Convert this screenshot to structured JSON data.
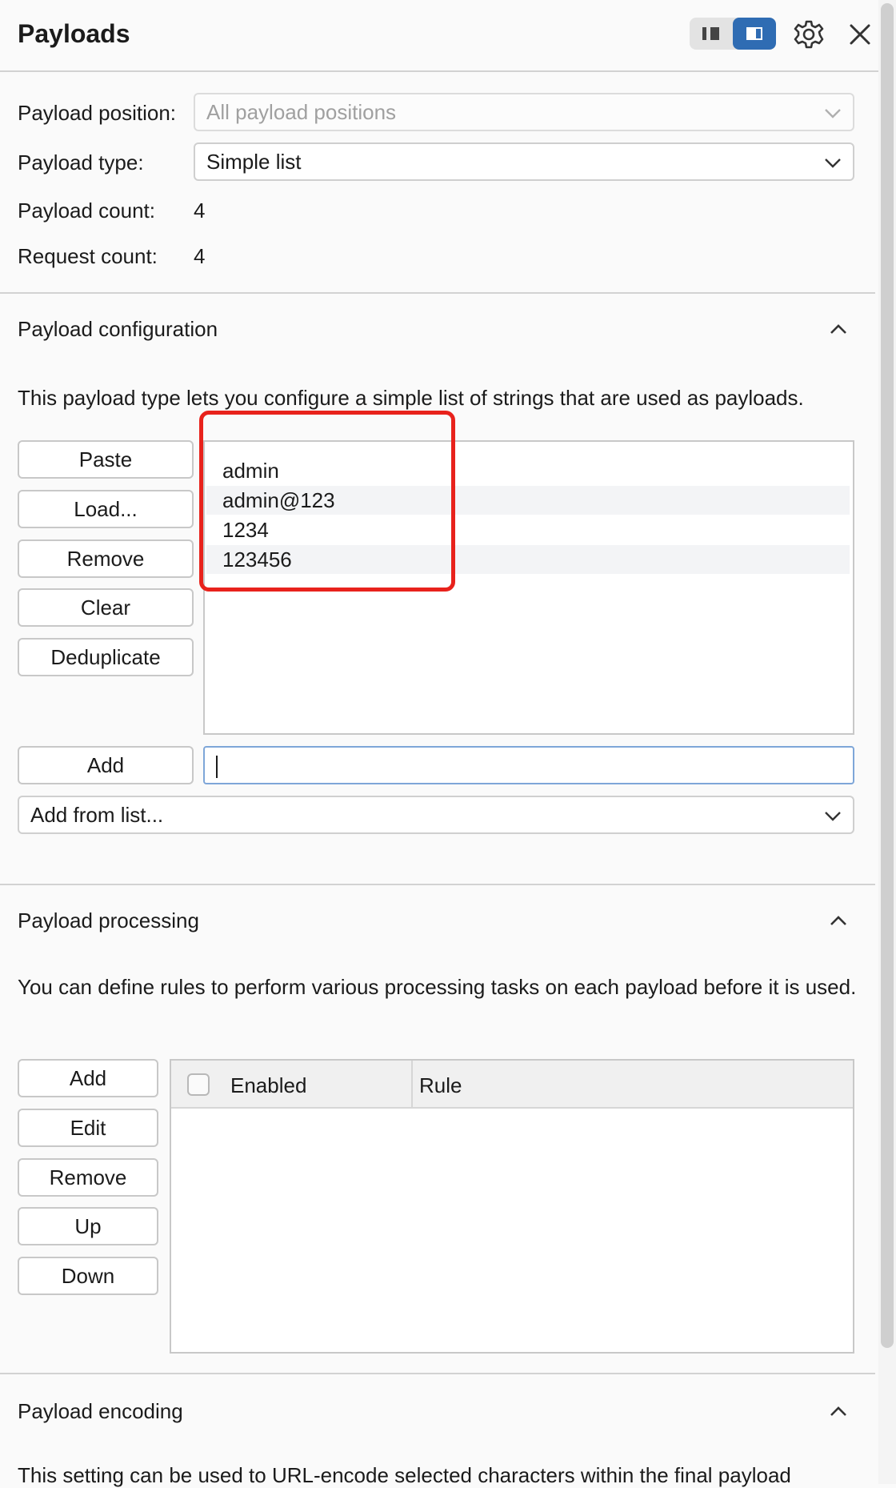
{
  "header": {
    "title": "Payloads"
  },
  "sets": {
    "position_label": "Payload position:",
    "position_value": "All payload positions",
    "type_label": "Payload type:",
    "type_value": "Simple list",
    "count_label": "Payload count:",
    "count_value": "4",
    "request_label": "Request count:",
    "request_value": "4"
  },
  "configuration": {
    "title": "Payload configuration",
    "description": "This payload type lets you configure a simple list of strings that are used as payloads.",
    "buttons": {
      "paste": "Paste",
      "load": "Load...",
      "remove": "Remove",
      "clear": "Clear",
      "deduplicate": "Deduplicate",
      "add": "Add"
    },
    "items": [
      "admin",
      "admin@123",
      "1234",
      "123456"
    ],
    "add_input_value": "",
    "add_from_list": "Add from list..."
  },
  "processing": {
    "title": "Payload processing",
    "description": "You can define rules to perform various processing tasks on each payload before it is used.",
    "buttons": {
      "add": "Add",
      "edit": "Edit",
      "remove": "Remove",
      "up": "Up",
      "down": "Down"
    },
    "columns": [
      "Enabled",
      "Rule"
    ]
  },
  "encoding": {
    "title": "Payload encoding",
    "description_partial": "This setting can be used to URL-encode selected characters within the final payload"
  },
  "colors": {
    "accent": "#2f6cb3",
    "highlight": "#e8221c"
  }
}
